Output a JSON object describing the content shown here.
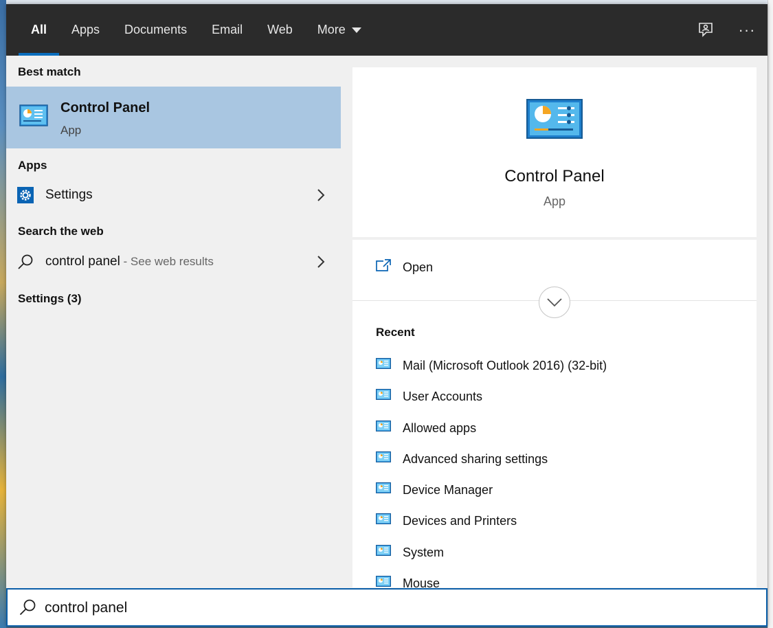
{
  "tabs": [
    {
      "label": "All",
      "active": true
    },
    {
      "label": "Apps"
    },
    {
      "label": "Documents"
    },
    {
      "label": "Email"
    },
    {
      "label": "Web"
    },
    {
      "label": "More"
    }
  ],
  "top_icons": [
    "feedback-icon",
    "more-options-icon"
  ],
  "top_more_label": "···",
  "left": {
    "best_match_header": "Best match",
    "best_match": {
      "title": "Control Panel",
      "subtitle": "App",
      "icon": "control-panel-icon"
    },
    "apps_header": "Apps",
    "apps": [
      {
        "label": "Settings",
        "icon": "gear-icon"
      }
    ],
    "web_header": "Search the web",
    "web": {
      "query": "control panel",
      "suffix": " - See web results",
      "icon": "search-icon"
    },
    "settings_header": "Settings (3)"
  },
  "right": {
    "title": "Control Panel",
    "subtitle": "App",
    "open_label": "Open",
    "recent_header": "Recent",
    "recent": [
      "Mail (Microsoft Outlook 2016) (32-bit)",
      "User Accounts",
      "Allowed apps",
      "Advanced sharing settings",
      "Device Manager",
      "Devices and Printers",
      "System",
      "Mouse"
    ]
  },
  "search": {
    "value": "control panel"
  },
  "colors": {
    "accent": "#0a6ebd",
    "selected": "#a9c6e1",
    "topbar": "#2b2b2b"
  }
}
